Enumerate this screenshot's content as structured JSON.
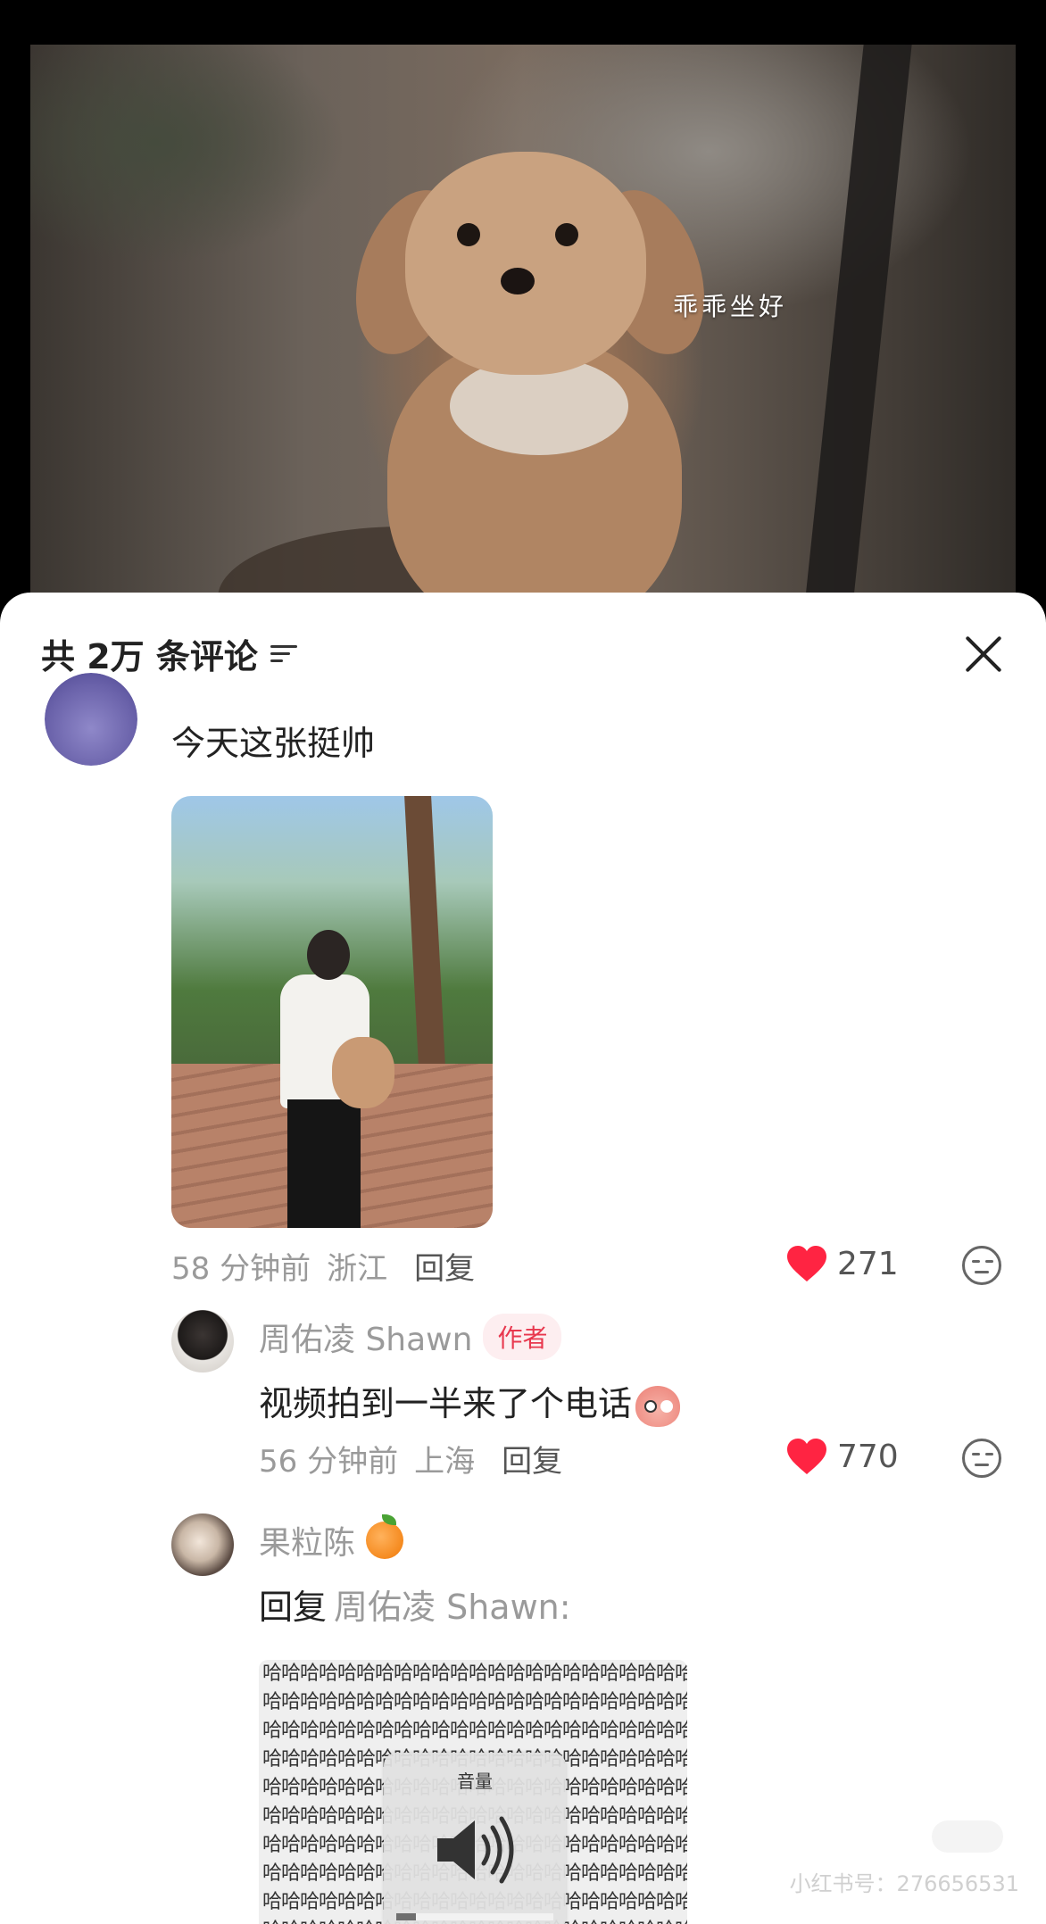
{
  "video": {
    "caption": "乖乖坐好"
  },
  "comments_panel": {
    "header": "共 2万 条评论"
  },
  "comment_main": {
    "text": "今天这张挺帅",
    "time": "58 分钟前",
    "location": "浙江",
    "reply_label": "回复",
    "likes": "271"
  },
  "reply_author": {
    "name": "周佑凌 Shawn",
    "badge": "作者",
    "text": "视频拍到一半来了个电话",
    "time": "56 分钟前",
    "location": "上海",
    "reply_label": "回复",
    "likes": "770"
  },
  "reply_guo": {
    "name": "果粒陈",
    "reply_prefix": "回复",
    "reply_to": "周佑凌 Shawn:",
    "image_text": "哈哈哈哈哈哈哈哈哈哈哈哈哈哈哈哈哈哈哈哈哈哈哈哈"
  },
  "volume_hud": {
    "label": "音量"
  },
  "watermark": {
    "text": "小红书号：276656531"
  },
  "icons": [
    "sort-icon",
    "close-icon",
    "heart-icon",
    "face-icon",
    "orange-emoji",
    "speaker-icon"
  ],
  "colors": {
    "heart": "#ff2442",
    "author_badge_text": "#e8384e",
    "author_badge_bg": "#fdeef0"
  }
}
